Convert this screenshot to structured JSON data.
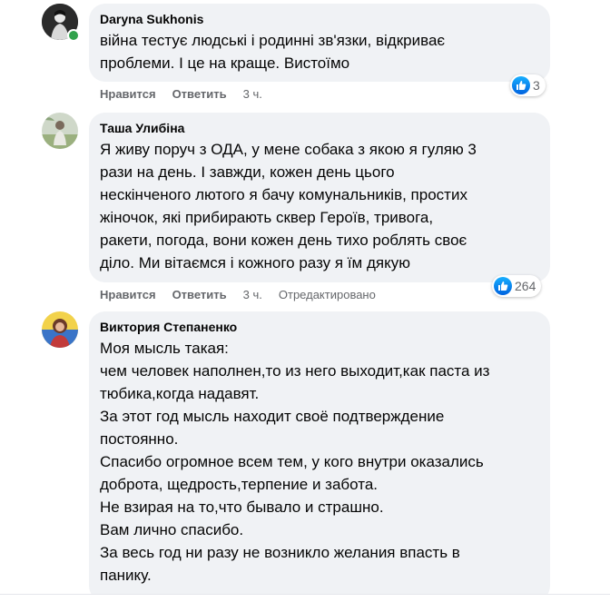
{
  "comments": [
    {
      "author": "Daryna Sukhonis",
      "lines": [
        "війна тестує людські і родинні зв'язки, відкриває",
        "проблеми. І це на краще. Вистоїмо"
      ],
      "like_label": "Нравится",
      "reply_label": "Ответить",
      "time": "3 ч.",
      "reactions_count": "3",
      "online": true
    },
    {
      "author": "Таша Улибіна",
      "lines": [
        "Я живу поруч з ОДА, у мене собака з якою я гуляю 3",
        "рази на день. І завжди, кожен день цього",
        "нескінченого лютого я бачу комунальників, простих",
        "жіночок, які прибирають сквер Героїв, тривога,",
        "ракети, погода, вони кожен день тихо роблять своє",
        "діло. Ми вітаємся і кожного разу я їм дякую"
      ],
      "like_label": "Нравится",
      "reply_label": "Ответить",
      "time": "3 ч.",
      "edited_label": "Отредактировано",
      "reactions_count": "264"
    },
    {
      "author": "Виктория Степаненко",
      "lines": [
        "Моя мысль такая:",
        "чем человек наполнен,то из него выходит,как паста из",
        "тюбика,когда надавят.",
        "За этот год мысль находит своё подтверждение",
        "постоянно.",
        "Спасибо огромное всем тем, у кого внутри оказались",
        "доброта, щедрость,терпение и забота.",
        "Не взирая на то,что бывало и страшно.",
        "Вам лично спасибо.",
        "За весь год ни разу не возникло желания впасть в",
        "панику."
      ]
    }
  ],
  "colors": {
    "bubble": "#f0f2f5",
    "meta_text": "#65676b",
    "like_blue": "#0866ff",
    "online": "#31a24c"
  },
  "icons": [
    "like-icon",
    "ukraine-flag-icon"
  ]
}
